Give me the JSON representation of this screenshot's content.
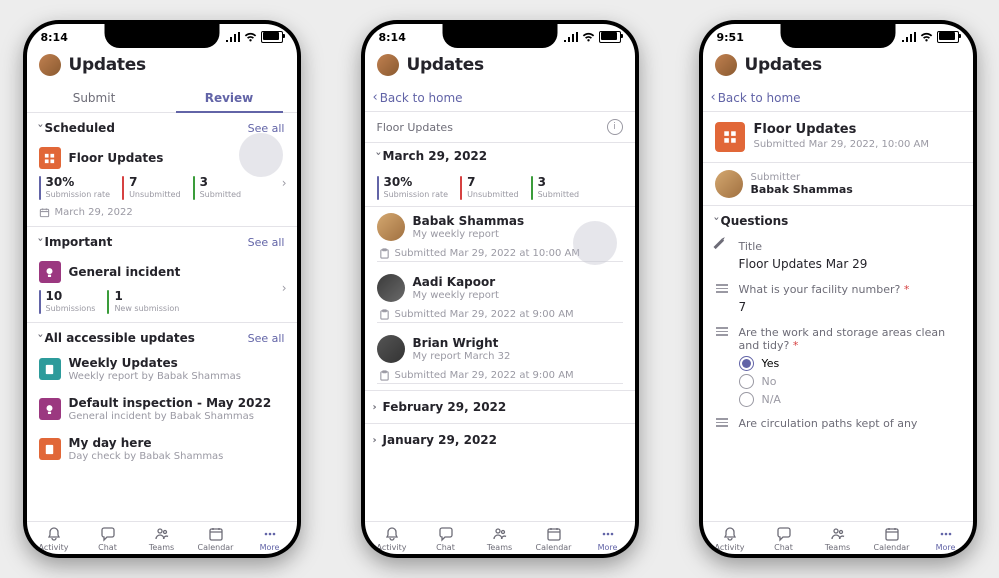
{
  "phones": {
    "p1": {
      "time": "8:14"
    },
    "p2": {
      "time": "8:14"
    },
    "p3": {
      "time": "9:51"
    }
  },
  "header": {
    "title": "Updates"
  },
  "tabs": {
    "submit": "Submit",
    "review": "Review"
  },
  "back": "Back to home",
  "sections": {
    "scheduled": "Scheduled",
    "important": "Important",
    "accessible": "All accessible updates",
    "seeAll": "See all"
  },
  "floor": {
    "title": "Floor Updates",
    "metrics": {
      "rate": {
        "value": "30%",
        "label": "Submission rate"
      },
      "unsub": {
        "value": "7",
        "label": "Unsubmitted"
      },
      "sub": {
        "value": "3",
        "label": "Submitted"
      }
    },
    "date": "March 29, 2022"
  },
  "incident": {
    "title": "General incident",
    "metrics": {
      "subs": {
        "value": "10",
        "label": "Submissions"
      },
      "newsub": {
        "value": "1",
        "label": "New submission"
      }
    }
  },
  "list": {
    "weekly": {
      "title": "Weekly Updates",
      "sub": "Weekly report by Babak Shammas"
    },
    "defaultInspection": {
      "title": "Default inspection - May 2022",
      "sub": "General incident by Babak Shammas"
    },
    "myday": {
      "title": "My day here",
      "sub": "Day check by Babak Shammas"
    }
  },
  "p2": {
    "header": "Floor Updates",
    "dateGroup": "March 29, 2022",
    "metrics": {
      "rate": {
        "value": "30%",
        "label": "Submission rate"
      },
      "unsub": {
        "value": "7",
        "label": "Unsubmitted"
      },
      "sub": {
        "value": "3",
        "label": "Submitted"
      }
    },
    "entries": {
      "e1": {
        "name": "Babak Shammas",
        "sub": "My weekly report",
        "time": "Submitted Mar 29, 2022 at 10:00 AM"
      },
      "e2": {
        "name": "Aadi Kapoor",
        "sub": "My weekly report",
        "time": "Submitted Mar 29, 2022 at 9:00 AM"
      },
      "e3": {
        "name": "Brian Wright",
        "sub": "My report March 32",
        "time": "Submitted Mar 29, 2022 at 9:00 AM"
      }
    },
    "groups": {
      "feb": "February 29, 2022",
      "jan": "January 29, 2022"
    }
  },
  "p3": {
    "title": "Floor Updates",
    "submitted": "Submitted Mar 29, 2022, 10:00 AM",
    "submitter": {
      "label": "Submitter",
      "name": "Babak Shammas"
    },
    "qhdr": "Questions",
    "q1": {
      "label": "Title",
      "value": "Floor Updates Mar 29"
    },
    "q2": {
      "label": "What is your facility number?",
      "value": "7"
    },
    "q3": {
      "label": "Are the work and storage areas clean and tidy?",
      "opts": {
        "yes": "Yes",
        "no": "No",
        "na": "N/A"
      }
    },
    "q4": {
      "label": "Are circulation paths kept of any"
    }
  },
  "nav": {
    "activity": "Activity",
    "chat": "Chat",
    "teams": "Teams",
    "calendar": "Calendar",
    "more": "More"
  }
}
